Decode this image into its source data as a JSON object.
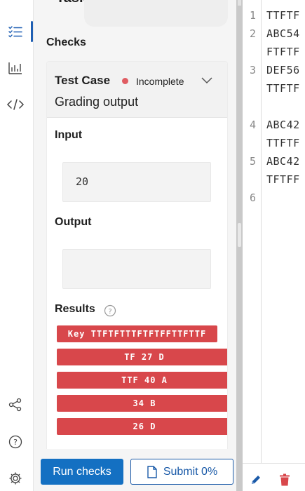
{
  "panel": {
    "title": "Tasks",
    "checks_label": "Checks"
  },
  "test_case": {
    "title": "Test Case",
    "status": "Incomplete",
    "subtitle": "Grading output",
    "status_color": "#e05c62"
  },
  "input": {
    "label": "Input",
    "value": "20"
  },
  "output": {
    "label": "Output",
    "value": ""
  },
  "results": {
    "label": "Results",
    "badges": [
      "Key TTFTFTTTFTFTFFTTFTTF",
      "TF 27 D",
      "TTF 40 A",
      "34 B",
      "26 D"
    ],
    "badge_color": "#d8474b"
  },
  "footer": {
    "run_label": "Run checks",
    "submit_label": "Submit 0%"
  },
  "editor": {
    "line_numbers": [
      "1",
      "2",
      "3",
      "4",
      "5",
      "6"
    ],
    "lines": [
      "TTFTF",
      "ABC54",
      "FTFTF",
      "DEF56",
      "TTFTF",
      "ABC42",
      "TTFTF",
      "ABC42",
      "TFTFF"
    ]
  },
  "rail": {
    "icons": [
      "task-list-icon",
      "bar-chart-icon",
      "code-icon",
      "share-icon",
      "help-icon",
      "settings-icon"
    ],
    "active_color": "#1f5fb3"
  },
  "colors": {
    "primary": "#1470c2",
    "danger": "#d8474b"
  }
}
